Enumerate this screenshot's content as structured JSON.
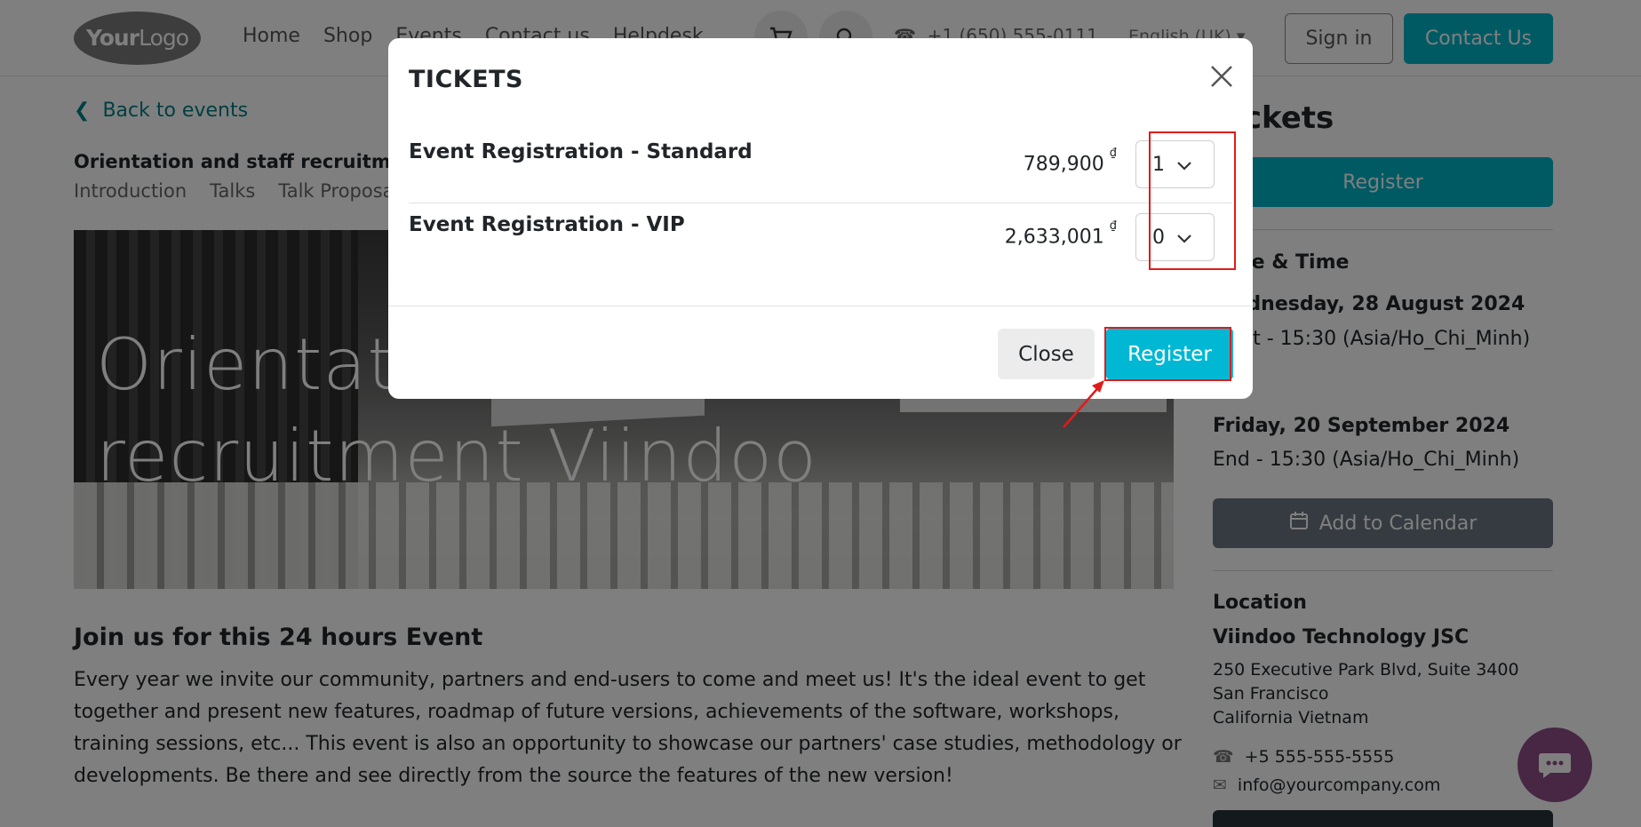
{
  "header": {
    "logo_text_bold": "Your",
    "logo_text_rest": "Logo",
    "nav": [
      "Home",
      "Shop",
      "Events",
      "Contact us",
      "Helpdesk"
    ],
    "phone": "+1 (650) 555-0111",
    "language": "English (UK)",
    "sign_in": "Sign in",
    "contact_us": "Contact Us"
  },
  "page": {
    "back_link": "Back to events",
    "event_title": "Orientation and staff recruitment Viindoo",
    "subnav": [
      "Introduction",
      "Talks",
      "Talk Proposals"
    ],
    "hero_line1": "Orientation and staff",
    "hero_line2": "recruitment Viindoo",
    "section_title": "Join us for this 24 hours Event",
    "section_body": "Every year we invite our community, partners and end-users to come and meet us! It's the ideal event to get together and present new features, roadmap of future versions, achievements of the software, workshops, training sessions, etc... This event is also an opportunity to showcase our partners' case studies, methodology or developments. Be there and see directly from the source the features of the new version!"
  },
  "sidebar": {
    "tickets_title": "Tickets",
    "register": "Register",
    "date_time_title": "Date & Time",
    "start_date": "Wednesday, 28 August 2024",
    "start_time": "Start - 15:30 (Asia/Ho_Chi_Minh)",
    "end_date": "Friday, 20 September 2024",
    "end_time": "End - 15:30 (Asia/Ho_Chi_Minh)",
    "add_to_calendar": "Add to Calendar",
    "location_title": "Location",
    "company": "Viindoo Technology JSC",
    "address1": "250 Executive Park Blvd, Suite 3400",
    "address2": "San Francisco",
    "address3": "California Vietnam",
    "phone": "+5 555-555-5555",
    "email": "info@yourcompany.com"
  },
  "modal": {
    "title": "TICKETS",
    "tickets": [
      {
        "name": "Event Registration - Standard",
        "price": "789,900",
        "currency": "₫",
        "quantity": "1"
      },
      {
        "name": "Event Registration - VIP",
        "price": "2,633,001",
        "currency": "₫",
        "quantity": "0"
      }
    ],
    "close": "Close",
    "register": "Register"
  },
  "colors": {
    "accent": "#00b4c8",
    "modal_register": "#00b8d4",
    "highlight": "#e01b1b",
    "chat": "#8e4f86",
    "calendar_button": "#6c7782"
  }
}
